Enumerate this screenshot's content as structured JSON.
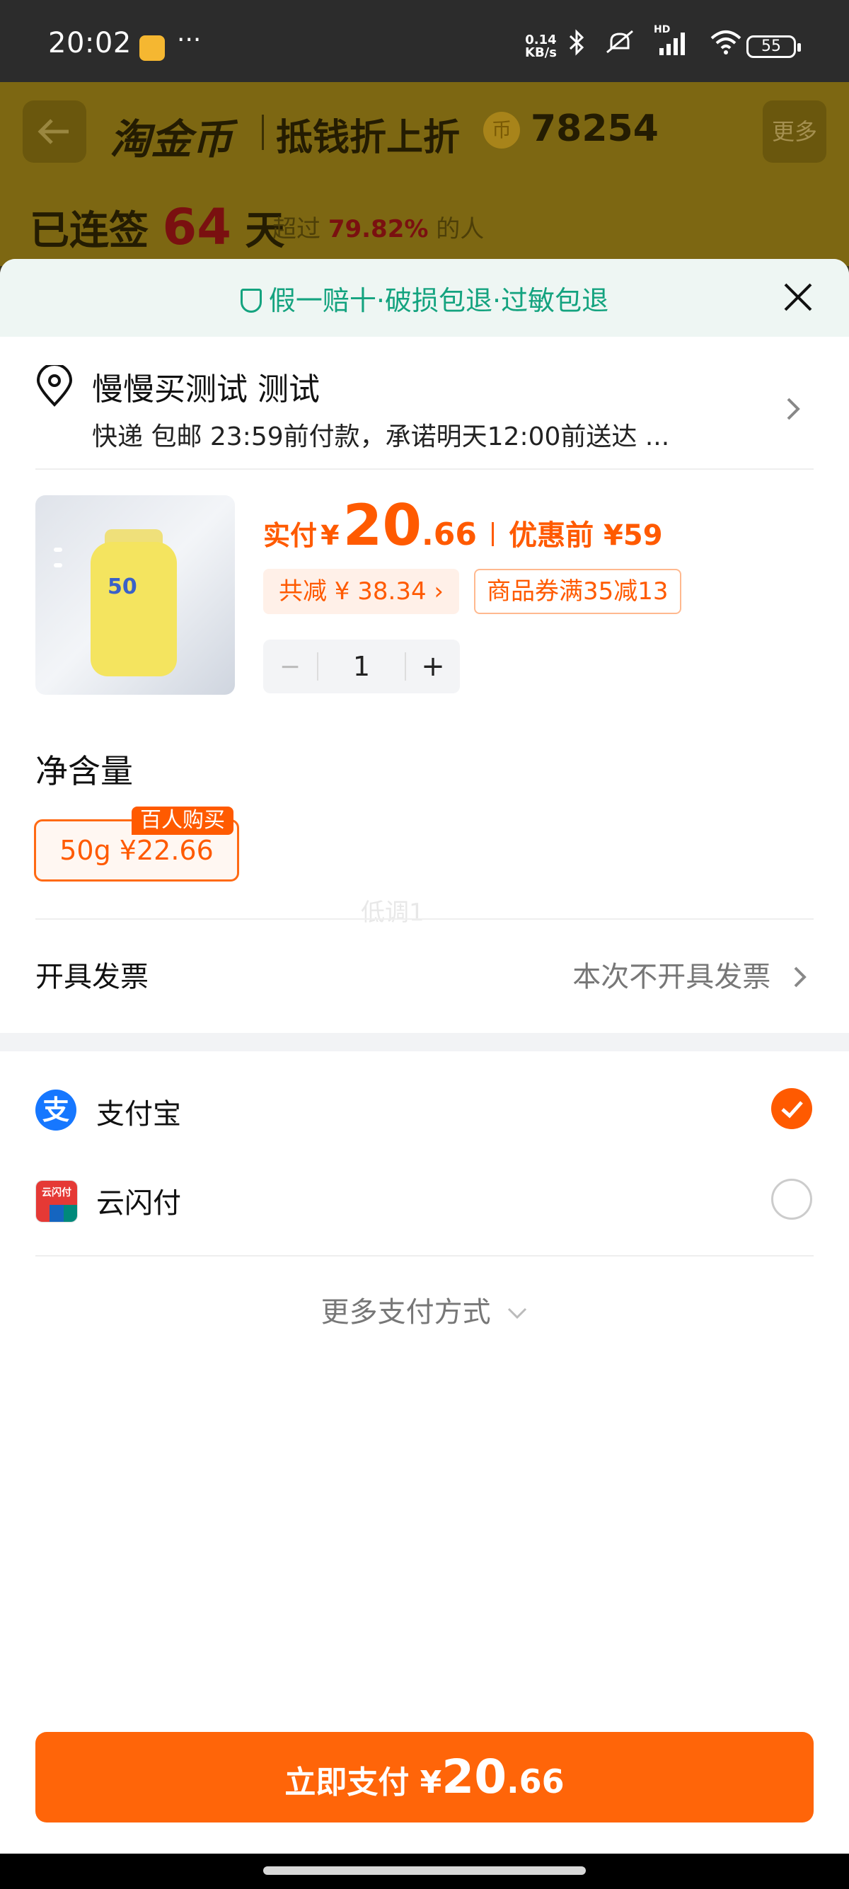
{
  "status_bar": {
    "time": "20:02",
    "more": "···",
    "net_speed_value": "0.14",
    "net_speed_unit": "KB/s",
    "signal_label": "HD",
    "battery": "55"
  },
  "background_page": {
    "back_icon": "arrow-left-icon",
    "brand": "淘金币",
    "subtitle": "抵钱折上折",
    "coin_icon_label": "币",
    "coin_count": "78254",
    "more_label": "更多",
    "sign_prefix": "已连签",
    "sign_days": "64",
    "sign_suffix": "天",
    "rank_prefix": "超过",
    "rank_pct": "79.82%",
    "rank_suffix": "的人"
  },
  "sheet": {
    "guarantee": "假一赔十·破损包退·过敏包退",
    "address": {
      "name": "慢慢买测试 测试",
      "shipping": "快递 包邮 23:59前付款，承诺明天12:00前送达 ..."
    },
    "product": {
      "bottle_label": "50",
      "price_label": "实付",
      "currency": "¥",
      "price_int": "20",
      "price_dec": ".66",
      "original_label": "优惠前 ¥59",
      "reduce_badge": "共减 ¥ 38.34 ›",
      "coupon_badge": "商品券满35减13",
      "minus": "−",
      "quantity": "1",
      "plus": "+"
    },
    "spec": {
      "title": "净含量",
      "option": "50g  ¥22.66",
      "badge": "百人购买"
    },
    "watermark": "低调1",
    "invoice": {
      "label": "开具发票",
      "value": "本次不开具发票"
    },
    "payments": [
      {
        "name": "支付宝",
        "icon": "alipay-icon",
        "icon_text": "支",
        "selected": true
      },
      {
        "name": "云闪付",
        "icon": "unionpay-icon",
        "icon_text": "云闪付",
        "selected": false
      }
    ],
    "more_payments": "更多支付方式",
    "pay_button": {
      "label": "立即支付 ¥",
      "amount_int": "20",
      "amount_dec": ".66"
    }
  },
  "colors": {
    "accent": "#ff5a00",
    "pay_button": "#ff6509",
    "guarantee_text": "#14a37f",
    "alipay": "#1677ff"
  }
}
